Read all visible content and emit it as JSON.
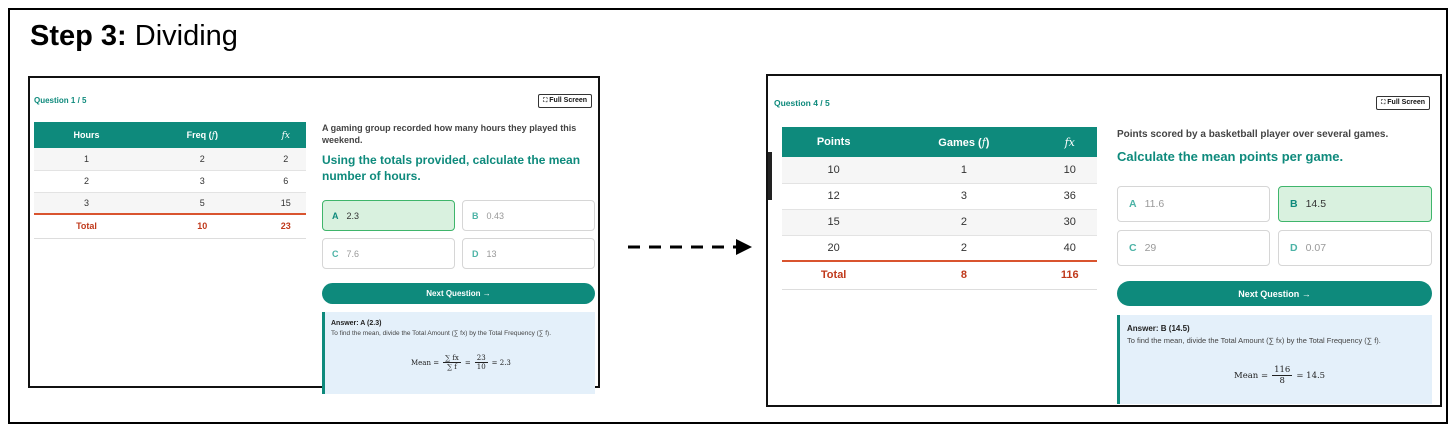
{
  "step": {
    "bold": "Step 3:",
    "text": " Dividing"
  },
  "card1": {
    "counter": "Question 1 / 5",
    "full_screen": "Full Screen",
    "table": {
      "headers": [
        "Hours",
        "Freq (",
        "f",
        ")",
        "fx"
      ],
      "rows": [
        [
          "1",
          "2",
          "2"
        ],
        [
          "2",
          "3",
          "6"
        ],
        [
          "3",
          "5",
          "15"
        ]
      ],
      "total": [
        "Total",
        "10",
        "23"
      ]
    },
    "prompt": "A gaming group recorded how many hours they played this weekend.",
    "question": "Using the totals provided, calculate the mean number of hours.",
    "options": [
      {
        "letter": "A",
        "value": "2.3",
        "selected": true
      },
      {
        "letter": "B",
        "value": "0.43",
        "selected": false
      },
      {
        "letter": "C",
        "value": "7.6",
        "selected": false
      },
      {
        "letter": "D",
        "value": "13",
        "selected": false
      }
    ],
    "next_label": "Next Question →",
    "answer_title": "Answer: A (2.3)",
    "answer_text": "To find the mean, divide the Total Amount (∑ fx) by the Total Frequency (∑ f).",
    "formula": {
      "lhs": "Mean =",
      "num1": "∑ fx",
      "den1": "∑ f",
      "eq": "=",
      "num2": "23",
      "den2": "10",
      "result": "= 2.3"
    }
  },
  "card2": {
    "counter": "Question 4 / 5",
    "full_screen": "Full Screen",
    "table": {
      "headers": [
        "Points",
        "Games (",
        "f",
        ")",
        "fx"
      ],
      "rows": [
        [
          "10",
          "1",
          "10"
        ],
        [
          "12",
          "3",
          "36"
        ],
        [
          "15",
          "2",
          "30"
        ],
        [
          "20",
          "2",
          "40"
        ]
      ],
      "total": [
        "Total",
        "8",
        "116"
      ]
    },
    "prompt": "Points scored by a basketball player over several games.",
    "question": "Calculate the mean points per game.",
    "options": [
      {
        "letter": "A",
        "value": "11.6",
        "selected": false
      },
      {
        "letter": "B",
        "value": "14.5",
        "selected": true
      },
      {
        "letter": "C",
        "value": "29",
        "selected": false
      },
      {
        "letter": "D",
        "value": "0.07",
        "selected": false
      }
    ],
    "next_label": "Next Question →",
    "answer_title": "Answer: B (14.5)",
    "answer_text": "To find the mean, divide the Total Amount (∑ fx) by the Total Frequency (∑ f).",
    "formula": {
      "lhs": "Mean =",
      "num2": "116",
      "den2": "8",
      "result": "= 14.5"
    }
  },
  "colors": {
    "teal": "#0e8a7c",
    "total_red": "#c0391b",
    "selected_green": "#d9f1df",
    "answer_bg": "#e4f0fa"
  },
  "icons": {
    "full_screen": "expand-icon",
    "arrow": "dashed-right-arrow"
  }
}
